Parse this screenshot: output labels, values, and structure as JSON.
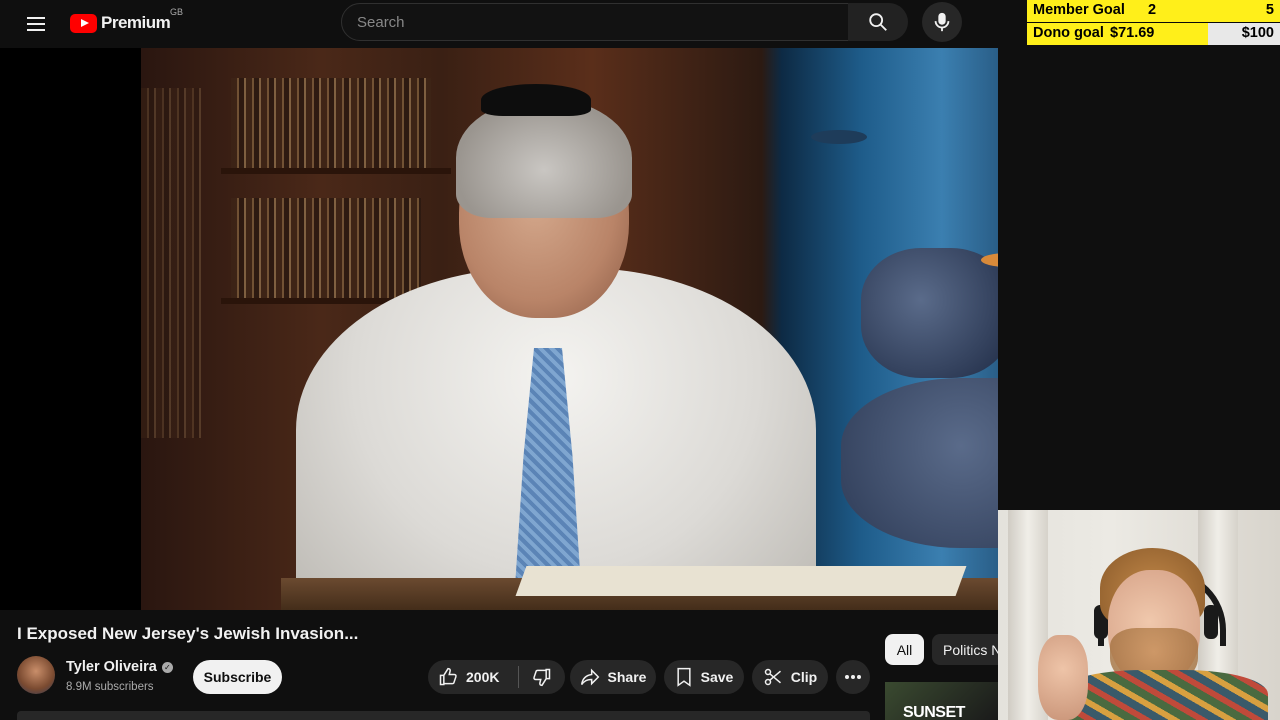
{
  "header": {
    "brand": "Premium",
    "country": "GB",
    "search_placeholder": "Search"
  },
  "overlay": {
    "member_label": "Member Goal",
    "member_current": "2",
    "member_target": "5",
    "dono_label": "Dono goal",
    "dono_current": "$71.69",
    "dono_target": "$100",
    "dono_progress": 0.717,
    "accent": "#ffef1a"
  },
  "video": {
    "title": "I Exposed New Jersey's Jewish Invasion...",
    "channel": "Tyler Oliveira",
    "subscribers": "8.9M subscribers",
    "subscribe_label": "Subscribe",
    "likes": "200K",
    "share_label": "Share",
    "save_label": "Save",
    "clip_label": "Clip"
  },
  "chips": {
    "all": "All",
    "politics": "Politics N"
  },
  "sidebar_thumb_text": "SUNSET",
  "icons": [
    "menu-icon",
    "youtube-logo-icon",
    "search-icon",
    "mic-icon",
    "like-icon",
    "dislike-icon",
    "share-icon",
    "save-icon",
    "clip-icon",
    "more-icon",
    "verified-icon"
  ]
}
